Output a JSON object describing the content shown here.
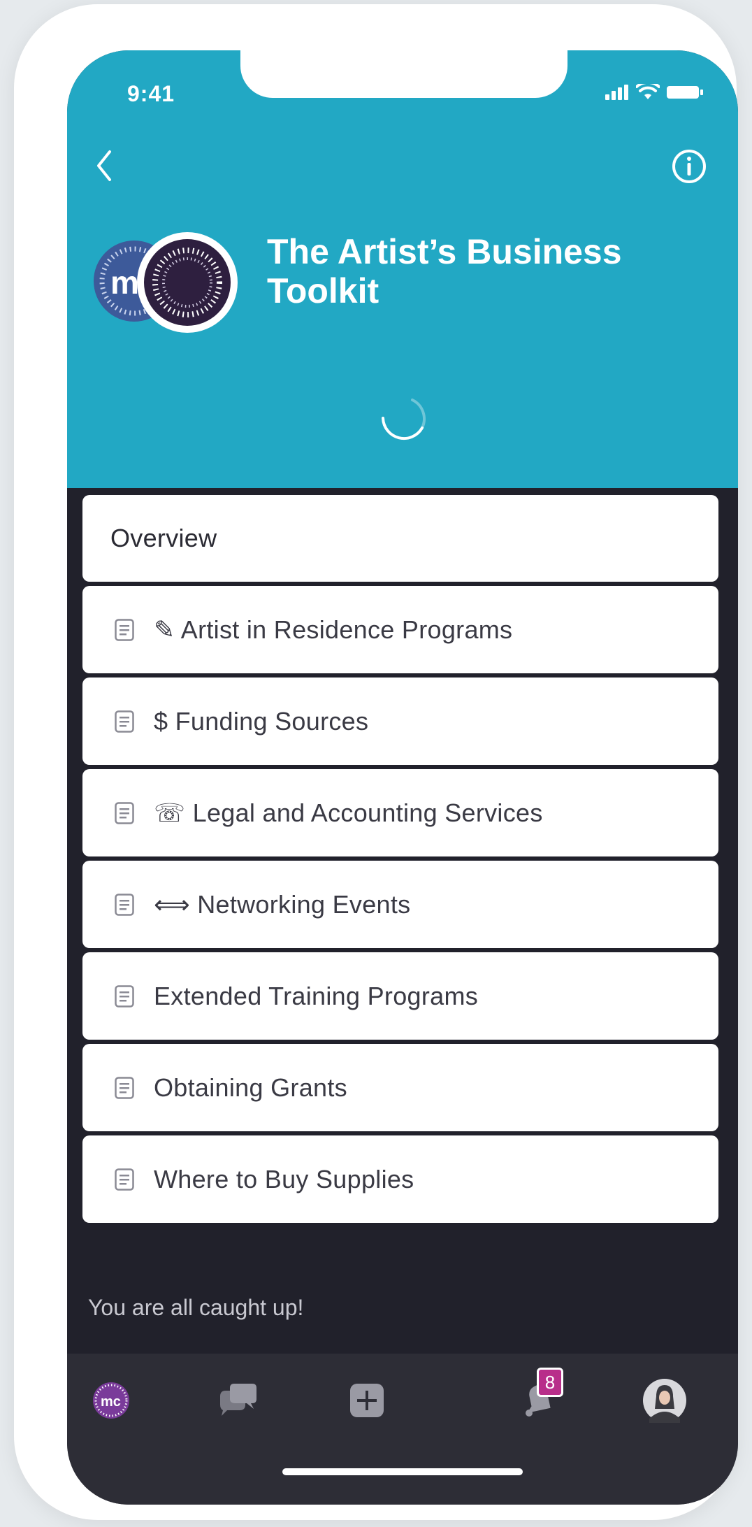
{
  "status_bar": {
    "time": "9:41"
  },
  "header": {
    "title": "The Artist’s Business Toolkit",
    "background_color": "#22a8c4",
    "back_icon": "chevron-left-icon",
    "info_icon": "info-circle-icon"
  },
  "list": {
    "overview_label": "Overview",
    "items": [
      {
        "label": "✎ Artist in Residence Programs"
      },
      {
        "label": "$ Funding Sources"
      },
      {
        "label": "☏ Legal and Accounting Services"
      },
      {
        "label": "⟺ Networking Events"
      },
      {
        "label": "Extended Training Programs"
      },
      {
        "label": "Obtaining Grants"
      },
      {
        "label": "Where to Buy Supplies"
      }
    ]
  },
  "footer": {
    "caught_up_text": "You are all caught up!"
  },
  "tabbar": {
    "tabs": [
      "community-tab",
      "messages-tab",
      "create-tab",
      "notifications-tab",
      "profile-tab"
    ],
    "notification_count": "8",
    "brand_accent": "#b82e8a",
    "logo_text": "mc"
  }
}
